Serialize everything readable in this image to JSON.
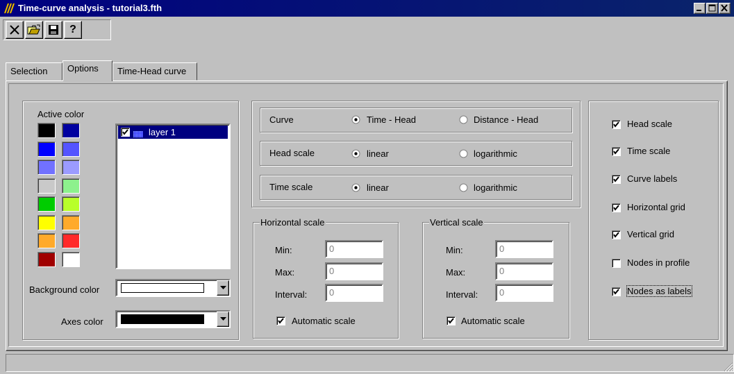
{
  "window": {
    "title": "Time-curve analysis - tutorial3.fth",
    "controls": [
      "minimize",
      "maximize",
      "close"
    ]
  },
  "toolbar": {
    "buttons": [
      {
        "name": "close-file",
        "icon": "x-icon",
        "label": "X"
      },
      {
        "name": "open",
        "icon": "folder-open-icon"
      },
      {
        "name": "save",
        "icon": "floppy-disk-icon"
      },
      {
        "name": "help",
        "icon": "question-icon",
        "label": "?"
      }
    ]
  },
  "tabs": [
    {
      "label": "Selection",
      "active": false
    },
    {
      "label": "Options",
      "active": true
    },
    {
      "label": "Time-Head curve",
      "active": false
    }
  ],
  "colors_panel": {
    "active_color_label": "Active color",
    "swatches": [
      "#000000",
      "#0000a0",
      "#0000ff",
      "#3333ff",
      "#5555ff",
      "#8888ff",
      "#bfbfbf",
      "#77ee77",
      "#00cc00",
      "#aaff00",
      "#ffff00",
      "#ff9900",
      "#ff9900",
      "#ff0000",
      "#a00000",
      "#ffffff"
    ],
    "layers": [
      {
        "name": "layer 1",
        "checked": true,
        "color": "#3333ff"
      }
    ],
    "background_color_label": "Background color",
    "background_color": "#ffffff",
    "axes_color_label": "Axes color",
    "axes_color": "#000000"
  },
  "curve_options": {
    "rows": [
      {
        "label": "Curve",
        "options": [
          "Time - Head",
          "Distance - Head"
        ],
        "selected": 0
      },
      {
        "label": "Head scale",
        "options": [
          "linear",
          "logarithmic"
        ],
        "selected": 0
      },
      {
        "label": "Time scale",
        "options": [
          "linear",
          "logarithmic"
        ],
        "selected": 0
      }
    ]
  },
  "horizontal_scale": {
    "title": "Horizontal scale",
    "min_label": "Min:",
    "min_value": "0",
    "max_label": "Max:",
    "max_value": "0",
    "interval_label": "Interval:",
    "interval_value": "0",
    "auto_label": "Automatic scale",
    "auto_checked": true
  },
  "vertical_scale": {
    "title": "Vertical scale",
    "min_label": "Min:",
    "min_value": "0",
    "max_label": "Max:",
    "max_value": "0",
    "interval_label": "Interval:",
    "interval_value": "0",
    "auto_label": "Automatic scale",
    "auto_checked": true
  },
  "display_options": [
    {
      "label": "Head scale",
      "checked": true
    },
    {
      "label": "Time scale",
      "checked": true
    },
    {
      "label": "Curve labels",
      "checked": true
    },
    {
      "label": "Horizontal grid",
      "checked": true
    },
    {
      "label": "Vertical grid",
      "checked": true
    },
    {
      "label": "Nodes in profile",
      "checked": false
    },
    {
      "label": "Nodes as labels",
      "checked": true
    }
  ]
}
